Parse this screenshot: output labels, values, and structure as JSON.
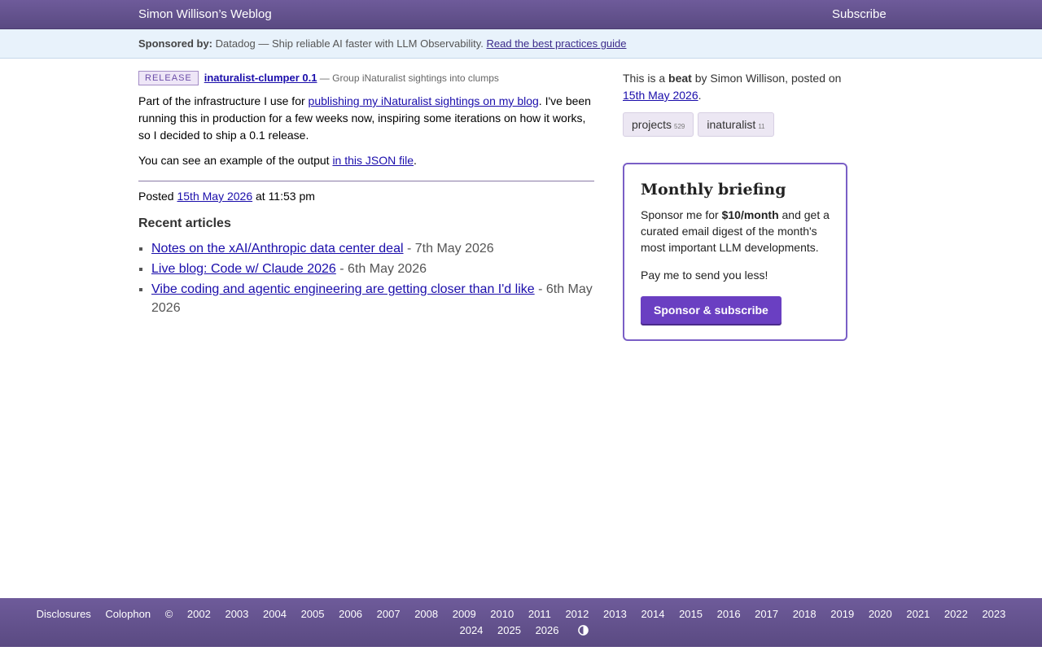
{
  "header": {
    "site_title": "Simon Willison’s Weblog",
    "subscribe_label": "Subscribe"
  },
  "sponsor": {
    "label": "Sponsored by:",
    "text": " Datadog — Ship reliable AI faster with LLM Observability. ",
    "link_text": "Read the best practices guide"
  },
  "entry": {
    "badge": "RELEASE",
    "title": "inaturalist-clumper 0.1",
    "description": " — Group iNaturalist sightings into clumps",
    "para1_before": "Part of the infrastructure I use for ",
    "para1_link": "publishing my iNaturalist sightings on my blog",
    "para1_after": ". I've been running this in production for a few weeks now, inspiring some iterations on how it works, so I decided to ship a 0.1 release.",
    "para2_before": "You can see an example of the output ",
    "para2_link": "in this JSON file",
    "para2_after": ".",
    "posted_prefix": "Posted ",
    "posted_date": "15th May 2026",
    "posted_time": " at 11:53 pm"
  },
  "recent": {
    "heading": "Recent articles",
    "items": [
      {
        "title": "Notes on the xAI/Anthropic data center deal",
        "date": " - 7th May 2026"
      },
      {
        "title": "Live blog: Code w/ Claude 2026",
        "date": " - 6th May 2026"
      },
      {
        "title": "Vibe coding and agentic engineering are getting closer than I'd like",
        "date": " - 6th May 2026"
      }
    ]
  },
  "sidebar": {
    "beat_prefix": "This is a ",
    "beat_word": "beat",
    "beat_middle": " by Simon Willison, posted on ",
    "beat_date": "15th May 2026",
    "beat_suffix": ".",
    "tags": [
      {
        "name": "projects",
        "count": "529"
      },
      {
        "name": "inaturalist",
        "count": "11"
      }
    ]
  },
  "briefing": {
    "title": "Monthly briefing",
    "text_prefix": "Sponsor me for ",
    "price": "$10/month",
    "text_suffix": " and get a curated email digest of the month's most important LLM developments.",
    "text2": "Pay me to send you less!",
    "button_label": "Sponsor & subscribe",
    "accent_color": "#6a3fc2"
  },
  "footer": {
    "disclosures": "Disclosures",
    "colophon": "Colophon",
    "copyright": "©",
    "years_row1": [
      "2002",
      "2003",
      "2004",
      "2005",
      "2006",
      "2007",
      "2008",
      "2009",
      "2010",
      "2011",
      "2012",
      "2013",
      "2014",
      "2015",
      "2016",
      "2017",
      "2018",
      "2019",
      "2020",
      "2021",
      "2022",
      "2023"
    ],
    "years_row2": [
      "2024",
      "2025",
      "2026"
    ],
    "contrast_icon": "contrast-toggle-icon"
  }
}
